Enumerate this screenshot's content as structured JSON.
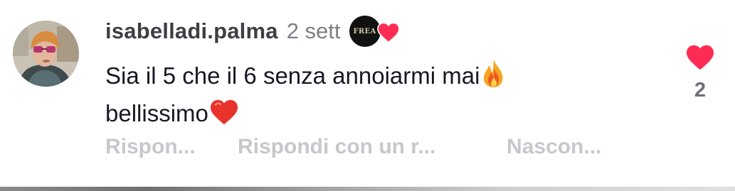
{
  "comment": {
    "username": "isabelladi.palma",
    "date": "2 sett",
    "creator_badge": {
      "logo_text": "FREA",
      "heart_color": "#fe2c55"
    },
    "text_line1": "Sia il 5 che il 6  senza annoiarmi mai",
    "text_line2": "bellissimo",
    "emoji1": "fire-emoji",
    "emoji2": "red-heart-emoji",
    "like_count": "2",
    "like_color": "#fe2c55"
  },
  "actions": {
    "reply": "Rispon...",
    "reply_with": "Rispondi con un r...",
    "hide": "Nascon..."
  }
}
